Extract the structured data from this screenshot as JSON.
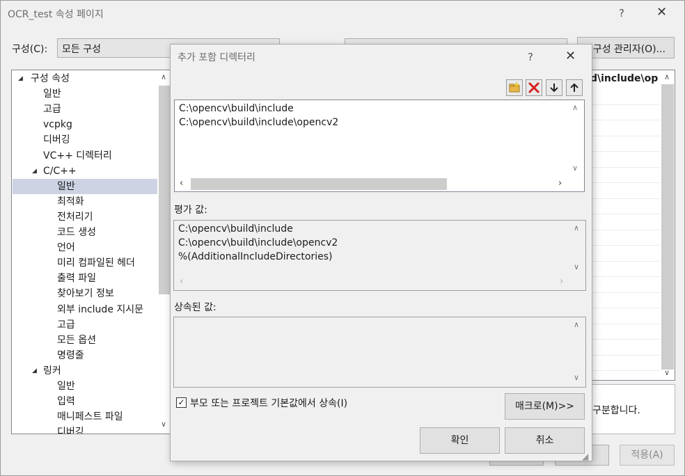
{
  "window": {
    "title": "OCR_test 속성 페이지",
    "help": "?",
    "close": "✕"
  },
  "config": {
    "label": "구성(C):",
    "value": "모든 구성",
    "manager_button": "구성 관리자(O)..."
  },
  "tree": {
    "items": [
      {
        "label": "구성 속성",
        "level": 0,
        "expanded": true
      },
      {
        "label": "일반",
        "level": 1
      },
      {
        "label": "고급",
        "level": 1
      },
      {
        "label": "vcpkg",
        "level": 1
      },
      {
        "label": "디버깅",
        "level": 1
      },
      {
        "label": "VC++ 디렉터리",
        "level": 1
      },
      {
        "label": "C/C++",
        "level": 1,
        "expanded": true
      },
      {
        "label": "일반",
        "level": 2,
        "selected": true
      },
      {
        "label": "최적화",
        "level": 2
      },
      {
        "label": "전처리기",
        "level": 2
      },
      {
        "label": "코드 생성",
        "level": 2
      },
      {
        "label": "언어",
        "level": 2
      },
      {
        "label": "미리 컴파일된 헤더",
        "level": 2
      },
      {
        "label": "출력 파일",
        "level": 2
      },
      {
        "label": "찾아보기 정보",
        "level": 2
      },
      {
        "label": "외부 include 지시문",
        "level": 2
      },
      {
        "label": "고급",
        "level": 2
      },
      {
        "label": "모든 옵션",
        "level": 2
      },
      {
        "label": "명령줄",
        "level": 2
      },
      {
        "label": "링커",
        "level": 1,
        "expanded": true
      },
      {
        "label": "일반",
        "level": 2
      },
      {
        "label": "입력",
        "level": 2
      },
      {
        "label": "매니페스트 파일",
        "level": 2
      },
      {
        "label": "디버깅",
        "level": 2
      }
    ]
  },
  "grid": {
    "header": "d\\include\\op"
  },
  "description": {
    "text": "구분합니다."
  },
  "main_buttons": {
    "apply": "적용(A)"
  },
  "dialog": {
    "title": "추가 포함 디렉터리",
    "help": "?",
    "close": "✕",
    "paths": [
      "C:\\opencv\\build\\include",
      "C:\\opencv\\build\\include\\opencv2"
    ],
    "eval_label": "평가 값:",
    "eval_lines": [
      "C:\\opencv\\build\\include",
      "C:\\opencv\\build\\include\\opencv2",
      "%(AdditionalIncludeDirectories)"
    ],
    "inherited_label": "상속된 값:",
    "inherit_checkbox": "부모 또는 프로젝트 기본값에서 상속(I)",
    "inherit_checked": true,
    "macro_button": "매크로(M)>>",
    "ok_button": "확인",
    "cancel_button": "취소"
  },
  "colors": {
    "selection": "#cdd3e3",
    "accent_yellow": "#e8b84a",
    "delete_red": "#d42020"
  }
}
